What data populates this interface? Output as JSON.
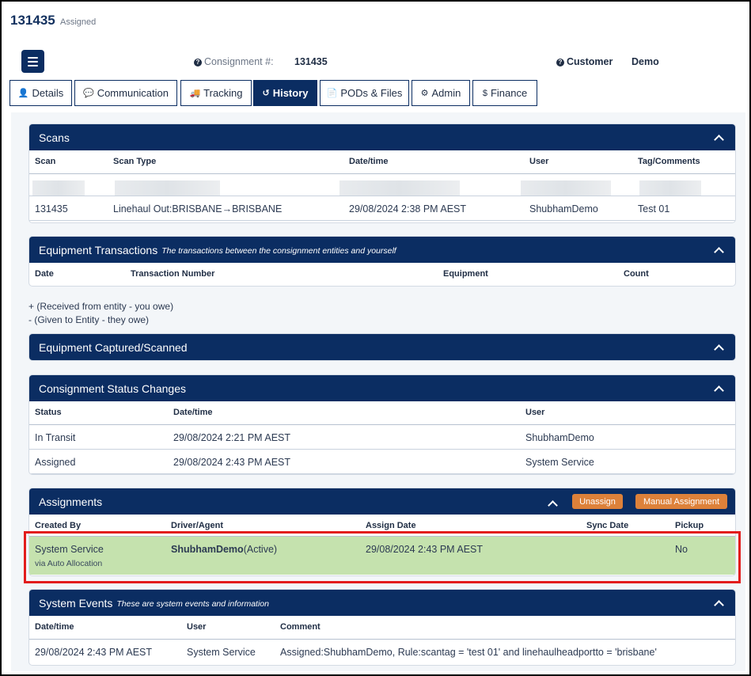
{
  "header": {
    "consignment_id": "131435",
    "status": "Assigned",
    "consignment_label": "Consignment #:",
    "consignment_value": "131435",
    "customer_label": "Customer",
    "customer_value": "Demo"
  },
  "tabs": [
    {
      "label": "Details",
      "icon": "user-icon"
    },
    {
      "label": "Communication",
      "icon": "comment-icon"
    },
    {
      "label": "Tracking",
      "icon": "truck-icon"
    },
    {
      "label": "History",
      "icon": "history-icon"
    },
    {
      "label": "PODs & Files",
      "icon": "file-icon"
    },
    {
      "label": "Admin",
      "icon": "gear-icon"
    },
    {
      "label": "Finance",
      "icon": "dollar-icon"
    }
  ],
  "active_tab": "History",
  "scans": {
    "title": "Scans",
    "columns": [
      "Scan",
      "Scan Type",
      "Date/time",
      "User",
      "Tag/Comments"
    ],
    "rows": [
      [
        "131435",
        "Linehaul Out:BRISBANE→BRISBANE",
        "29/08/2024 2:38 PM AEST",
        "ShubhamDemo",
        "Test 01"
      ]
    ]
  },
  "equipment_transactions": {
    "title": "Equipment Transactions",
    "subtitle": "The transactions between the consignment entities and yourself",
    "columns": [
      "Date",
      "Transaction Number",
      "Equipment",
      "Count"
    ]
  },
  "notes": {
    "received": "+ (Received from entity - you owe)",
    "given": "- (Given to Entity - they owe)"
  },
  "equipment_captured": {
    "title": "Equipment Captured/Scanned"
  },
  "status_changes": {
    "title": "Consignment Status Changes",
    "columns": [
      "Status",
      "Date/time",
      "User"
    ],
    "rows": [
      [
        "In Transit",
        "29/08/2024 2:21 PM AEST",
        "ShubhamDemo"
      ],
      [
        "Assigned",
        "29/08/2024 2:43 PM AEST",
        "System Service"
      ]
    ]
  },
  "assignments": {
    "title": "Assignments",
    "unassign_label": "Unassign",
    "manual_label": "Manual Assignment",
    "columns": [
      "Created By",
      "Driver/Agent",
      "Assign Date",
      "Sync Date",
      "Pickup"
    ],
    "row": {
      "created_by": "System Service",
      "created_via": "via Auto Allocation",
      "driver": "ShubhamDemo",
      "driver_status": "(Active)",
      "assign_date": "29/08/2024 2:43 PM AEST",
      "sync_date": "",
      "pickup": "No"
    },
    "highlight_color": "#e21c1c"
  },
  "system_events": {
    "title": "System Events",
    "subtitle": "These are system events and information",
    "columns": [
      "Date/time",
      "User",
      "Comment"
    ],
    "rows": [
      [
        "29/08/2024 2:43 PM AEST",
        "System Service",
        "Assigned:ShubhamDemo, Rule:scantag = 'test 01' and linehaulheadportto = 'brisbane'"
      ]
    ]
  },
  "colors": {
    "primary": "#0b2d62",
    "accent": "#dd813a",
    "success_row": "#c5e2ae"
  }
}
